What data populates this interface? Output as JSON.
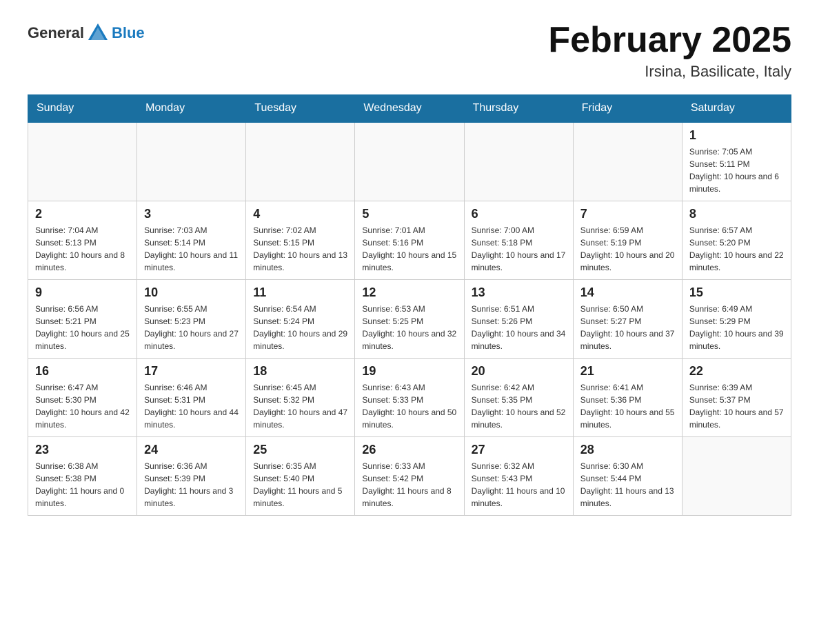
{
  "header": {
    "logo_text_general": "General",
    "logo_text_blue": "Blue",
    "month_title": "February 2025",
    "subtitle": "Irsina, Basilicate, Italy"
  },
  "weekdays": [
    "Sunday",
    "Monday",
    "Tuesday",
    "Wednesday",
    "Thursday",
    "Friday",
    "Saturday"
  ],
  "weeks": [
    [
      {
        "day": "",
        "sunrise": "",
        "sunset": "",
        "daylight": ""
      },
      {
        "day": "",
        "sunrise": "",
        "sunset": "",
        "daylight": ""
      },
      {
        "day": "",
        "sunrise": "",
        "sunset": "",
        "daylight": ""
      },
      {
        "day": "",
        "sunrise": "",
        "sunset": "",
        "daylight": ""
      },
      {
        "day": "",
        "sunrise": "",
        "sunset": "",
        "daylight": ""
      },
      {
        "day": "",
        "sunrise": "",
        "sunset": "",
        "daylight": ""
      },
      {
        "day": "1",
        "sunrise": "Sunrise: 7:05 AM",
        "sunset": "Sunset: 5:11 PM",
        "daylight": "Daylight: 10 hours and 6 minutes."
      }
    ],
    [
      {
        "day": "2",
        "sunrise": "Sunrise: 7:04 AM",
        "sunset": "Sunset: 5:13 PM",
        "daylight": "Daylight: 10 hours and 8 minutes."
      },
      {
        "day": "3",
        "sunrise": "Sunrise: 7:03 AM",
        "sunset": "Sunset: 5:14 PM",
        "daylight": "Daylight: 10 hours and 11 minutes."
      },
      {
        "day": "4",
        "sunrise": "Sunrise: 7:02 AM",
        "sunset": "Sunset: 5:15 PM",
        "daylight": "Daylight: 10 hours and 13 minutes."
      },
      {
        "day": "5",
        "sunrise": "Sunrise: 7:01 AM",
        "sunset": "Sunset: 5:16 PM",
        "daylight": "Daylight: 10 hours and 15 minutes."
      },
      {
        "day": "6",
        "sunrise": "Sunrise: 7:00 AM",
        "sunset": "Sunset: 5:18 PM",
        "daylight": "Daylight: 10 hours and 17 minutes."
      },
      {
        "day": "7",
        "sunrise": "Sunrise: 6:59 AM",
        "sunset": "Sunset: 5:19 PM",
        "daylight": "Daylight: 10 hours and 20 minutes."
      },
      {
        "day": "8",
        "sunrise": "Sunrise: 6:57 AM",
        "sunset": "Sunset: 5:20 PM",
        "daylight": "Daylight: 10 hours and 22 minutes."
      }
    ],
    [
      {
        "day": "9",
        "sunrise": "Sunrise: 6:56 AM",
        "sunset": "Sunset: 5:21 PM",
        "daylight": "Daylight: 10 hours and 25 minutes."
      },
      {
        "day": "10",
        "sunrise": "Sunrise: 6:55 AM",
        "sunset": "Sunset: 5:23 PM",
        "daylight": "Daylight: 10 hours and 27 minutes."
      },
      {
        "day": "11",
        "sunrise": "Sunrise: 6:54 AM",
        "sunset": "Sunset: 5:24 PM",
        "daylight": "Daylight: 10 hours and 29 minutes."
      },
      {
        "day": "12",
        "sunrise": "Sunrise: 6:53 AM",
        "sunset": "Sunset: 5:25 PM",
        "daylight": "Daylight: 10 hours and 32 minutes."
      },
      {
        "day": "13",
        "sunrise": "Sunrise: 6:51 AM",
        "sunset": "Sunset: 5:26 PM",
        "daylight": "Daylight: 10 hours and 34 minutes."
      },
      {
        "day": "14",
        "sunrise": "Sunrise: 6:50 AM",
        "sunset": "Sunset: 5:27 PM",
        "daylight": "Daylight: 10 hours and 37 minutes."
      },
      {
        "day": "15",
        "sunrise": "Sunrise: 6:49 AM",
        "sunset": "Sunset: 5:29 PM",
        "daylight": "Daylight: 10 hours and 39 minutes."
      }
    ],
    [
      {
        "day": "16",
        "sunrise": "Sunrise: 6:47 AM",
        "sunset": "Sunset: 5:30 PM",
        "daylight": "Daylight: 10 hours and 42 minutes."
      },
      {
        "day": "17",
        "sunrise": "Sunrise: 6:46 AM",
        "sunset": "Sunset: 5:31 PM",
        "daylight": "Daylight: 10 hours and 44 minutes."
      },
      {
        "day": "18",
        "sunrise": "Sunrise: 6:45 AM",
        "sunset": "Sunset: 5:32 PM",
        "daylight": "Daylight: 10 hours and 47 minutes."
      },
      {
        "day": "19",
        "sunrise": "Sunrise: 6:43 AM",
        "sunset": "Sunset: 5:33 PM",
        "daylight": "Daylight: 10 hours and 50 minutes."
      },
      {
        "day": "20",
        "sunrise": "Sunrise: 6:42 AM",
        "sunset": "Sunset: 5:35 PM",
        "daylight": "Daylight: 10 hours and 52 minutes."
      },
      {
        "day": "21",
        "sunrise": "Sunrise: 6:41 AM",
        "sunset": "Sunset: 5:36 PM",
        "daylight": "Daylight: 10 hours and 55 minutes."
      },
      {
        "day": "22",
        "sunrise": "Sunrise: 6:39 AM",
        "sunset": "Sunset: 5:37 PM",
        "daylight": "Daylight: 10 hours and 57 minutes."
      }
    ],
    [
      {
        "day": "23",
        "sunrise": "Sunrise: 6:38 AM",
        "sunset": "Sunset: 5:38 PM",
        "daylight": "Daylight: 11 hours and 0 minutes."
      },
      {
        "day": "24",
        "sunrise": "Sunrise: 6:36 AM",
        "sunset": "Sunset: 5:39 PM",
        "daylight": "Daylight: 11 hours and 3 minutes."
      },
      {
        "day": "25",
        "sunrise": "Sunrise: 6:35 AM",
        "sunset": "Sunset: 5:40 PM",
        "daylight": "Daylight: 11 hours and 5 minutes."
      },
      {
        "day": "26",
        "sunrise": "Sunrise: 6:33 AM",
        "sunset": "Sunset: 5:42 PM",
        "daylight": "Daylight: 11 hours and 8 minutes."
      },
      {
        "day": "27",
        "sunrise": "Sunrise: 6:32 AM",
        "sunset": "Sunset: 5:43 PM",
        "daylight": "Daylight: 11 hours and 10 minutes."
      },
      {
        "day": "28",
        "sunrise": "Sunrise: 6:30 AM",
        "sunset": "Sunset: 5:44 PM",
        "daylight": "Daylight: 11 hours and 13 minutes."
      },
      {
        "day": "",
        "sunrise": "",
        "sunset": "",
        "daylight": ""
      }
    ]
  ]
}
